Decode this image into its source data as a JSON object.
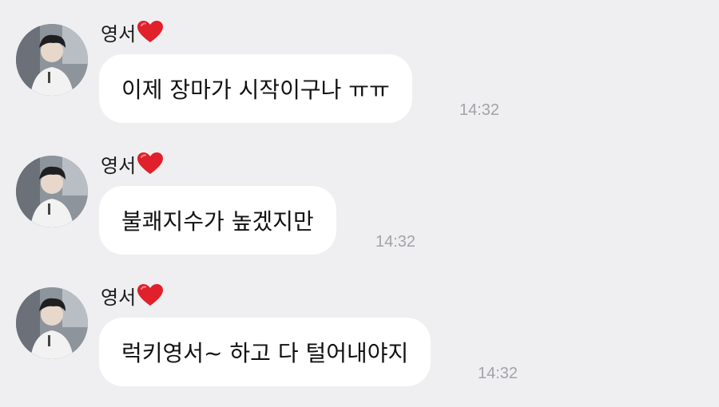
{
  "messages": [
    {
      "sender": "영서",
      "text": "이제 장마가 시작이구나 ㅠㅠ",
      "time": "14:32"
    },
    {
      "sender": "영서",
      "text": "불쾌지수가 높겠지만",
      "time": "14:32"
    },
    {
      "sender": "영서",
      "text": "럭키영서~ 하고 다 털어내야지",
      "time": "14:32"
    }
  ],
  "colors": {
    "background": "#efeff1",
    "bubble": "#ffffff",
    "heart": "#e0202a",
    "timestamp": "#a3a3a8"
  },
  "icons": {
    "sender_suffix": "red-heart-icon"
  }
}
